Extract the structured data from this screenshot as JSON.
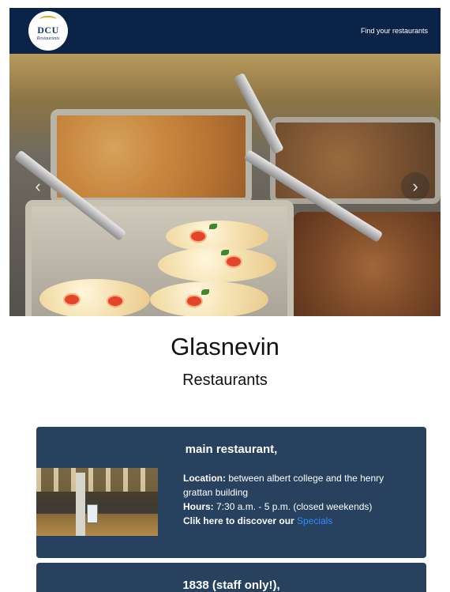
{
  "nav": {
    "logo_line1": "DCU",
    "logo_line2": "Restaurants",
    "link": "Find your restaurants"
  },
  "hero": {
    "prev_icon": "chevron-left-icon",
    "next_icon": "chevron-right-icon",
    "prev_glyph": "‹",
    "next_glyph": "›"
  },
  "page": {
    "title": "Glasnevin",
    "subtitle": "Restaurants"
  },
  "restaurants": [
    {
      "name": "main restaurant,",
      "location_label": "Location:",
      "location_value": " between albert college and the henry grattan building",
      "hours_label": "Hours:",
      "hours_value": " 7:30 a.m. - 5 p.m. (closed weekends)",
      "cta_text": "Clik here to discover our ",
      "cta_link": "Specials"
    },
    {
      "name": "1838",
      "name_suffix": " (staff only!),"
    }
  ],
  "colors": {
    "navbar": "#0b2347",
    "card": "#27415f",
    "link": "#2f8cff"
  }
}
